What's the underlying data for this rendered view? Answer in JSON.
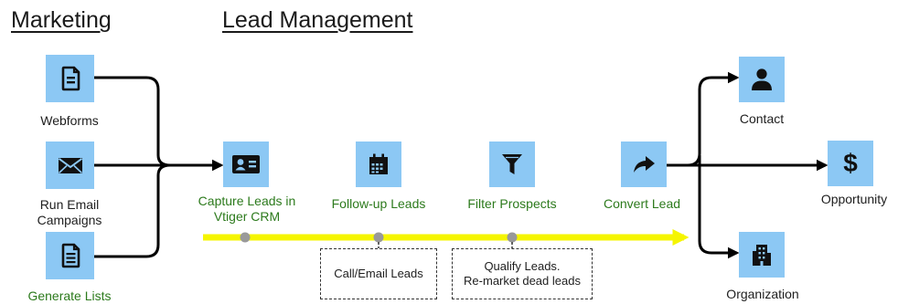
{
  "headings": {
    "marketing": "Marketing",
    "lead_management": "Lead Management"
  },
  "sources": [
    {
      "label": "Webforms",
      "icon": "document-icon"
    },
    {
      "label": "Run Email\nCampaigns",
      "icon": "envelope-icon"
    },
    {
      "label": "Generate Lists",
      "icon": "list-document-icon"
    }
  ],
  "stages": [
    {
      "label": "Capture Leads in\nVtiger CRM",
      "icon": "contact-card-icon"
    },
    {
      "label": "Follow-up Leads",
      "icon": "calendar-icon"
    },
    {
      "label": "Filter Prospects",
      "icon": "funnel-icon"
    },
    {
      "label": "Convert Lead",
      "icon": "share-arrow-icon"
    }
  ],
  "outcomes": [
    {
      "label": "Contact",
      "icon": "person-icon"
    },
    {
      "label": "Opportunity",
      "icon": "dollar-icon"
    },
    {
      "label": "Organization",
      "icon": "building-icon"
    }
  ],
  "notes": {
    "call_email": "Call/Email Leads",
    "qualify": "Qualify Leads.\nRe-market dead leads"
  },
  "colors": {
    "node_fill": "#8cc8f4",
    "connector": "#000000",
    "timeline": "#f5f500",
    "timeline_marker": "#999999",
    "stage_label": "#2c7a1c",
    "dark_label": "#1e1e1e"
  }
}
